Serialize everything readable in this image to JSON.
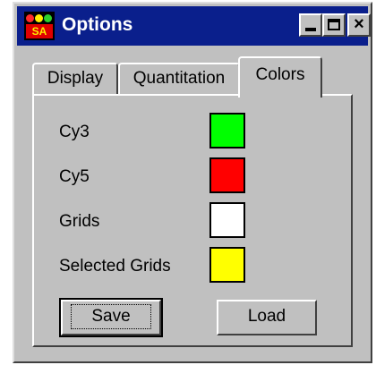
{
  "window": {
    "title": "Options",
    "icon_text": "SA",
    "close_glyph": "×"
  },
  "tabs": [
    {
      "label": "Display",
      "selected": false
    },
    {
      "label": "Quantitation",
      "selected": false
    },
    {
      "label": "Colors",
      "selected": true
    }
  ],
  "color_rows": [
    {
      "label": "Cy3",
      "color": "#00ff00"
    },
    {
      "label": "Cy5",
      "color": "#ff0000"
    },
    {
      "label": "Grids",
      "color": "#ffffff"
    },
    {
      "label": "Selected Grids",
      "color": "#ffff00"
    }
  ],
  "buttons": {
    "save_label": "Save",
    "load_label": "Load"
  }
}
